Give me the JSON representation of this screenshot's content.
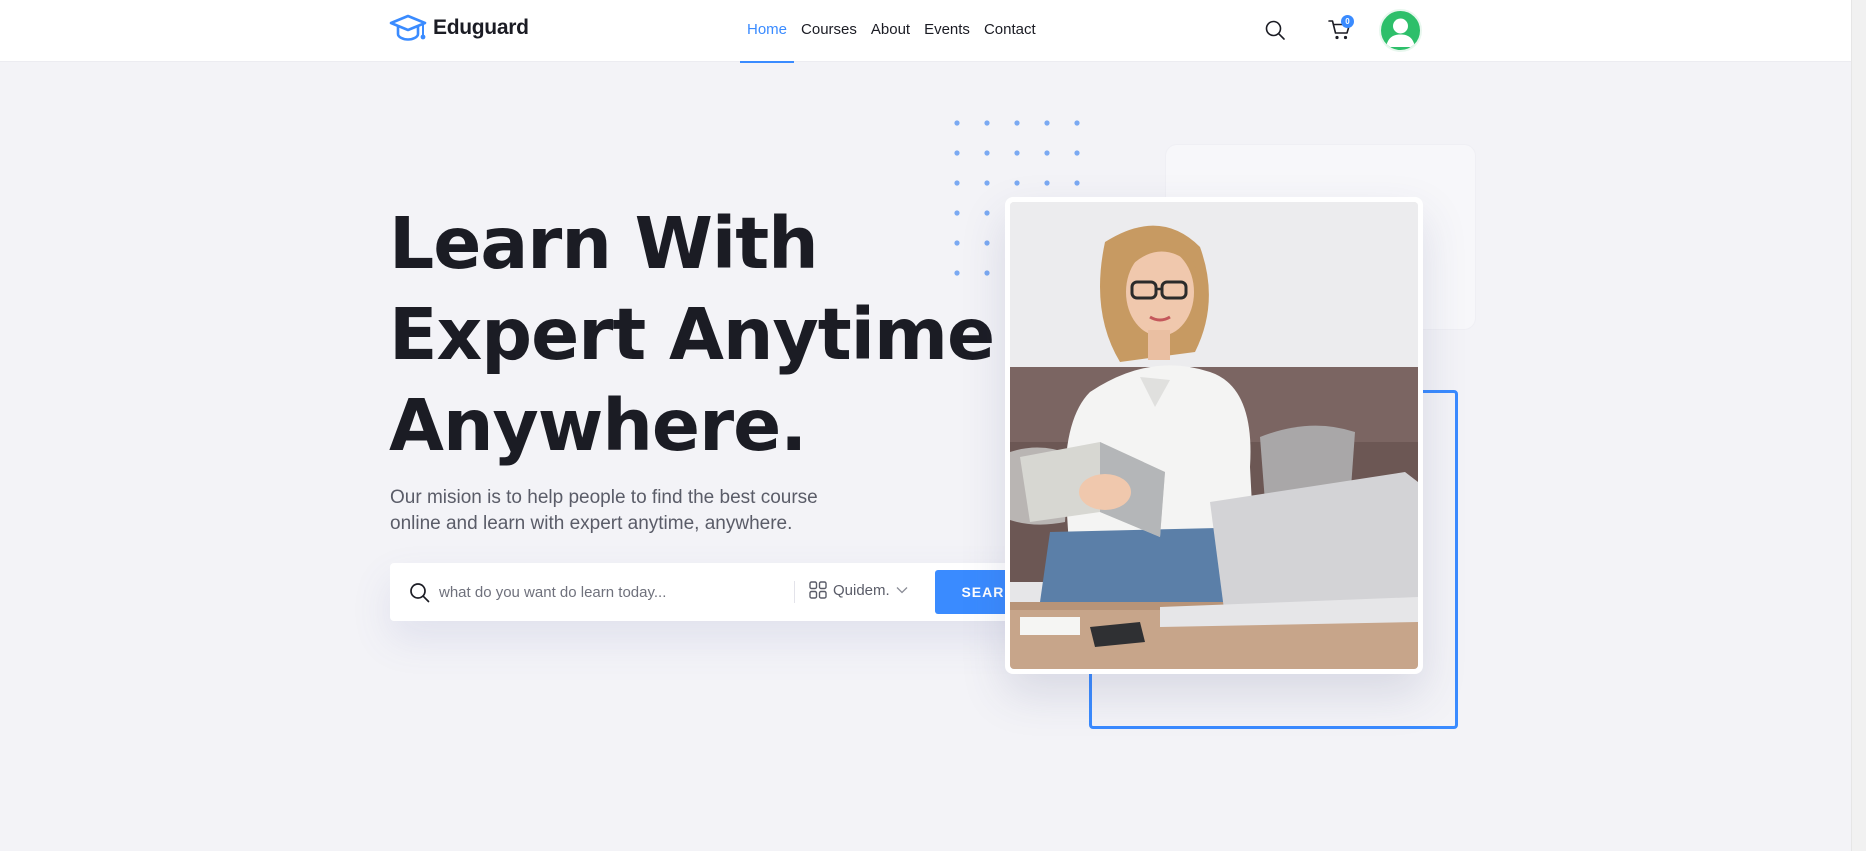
{
  "brand": {
    "name": "Eduguard"
  },
  "nav": {
    "items": [
      {
        "label": "Home",
        "active": true
      },
      {
        "label": "Courses",
        "active": false
      },
      {
        "label": "About",
        "active": false
      },
      {
        "label": "Events",
        "active": false
      },
      {
        "label": "Contact",
        "active": false
      }
    ]
  },
  "header": {
    "cart_count": "0",
    "icons": [
      "search-icon",
      "cart-icon",
      "user-avatar"
    ]
  },
  "hero": {
    "title_line1": "Learn With",
    "title_line2": "Expert Anytime",
    "title_line3": "Anywhere.",
    "description_line1": "Our mision is to help people to find the best course",
    "description_line2": "online and learn with expert anytime, anywhere."
  },
  "search": {
    "placeholder": "what do you want do learn today...",
    "category_label": "Quidem.",
    "button_label": "SEARCH"
  },
  "colors": {
    "accent": "#3a8bff",
    "heading": "#1b1c24",
    "background": "#f3f3f7",
    "avatar": "#2dbf6a"
  }
}
